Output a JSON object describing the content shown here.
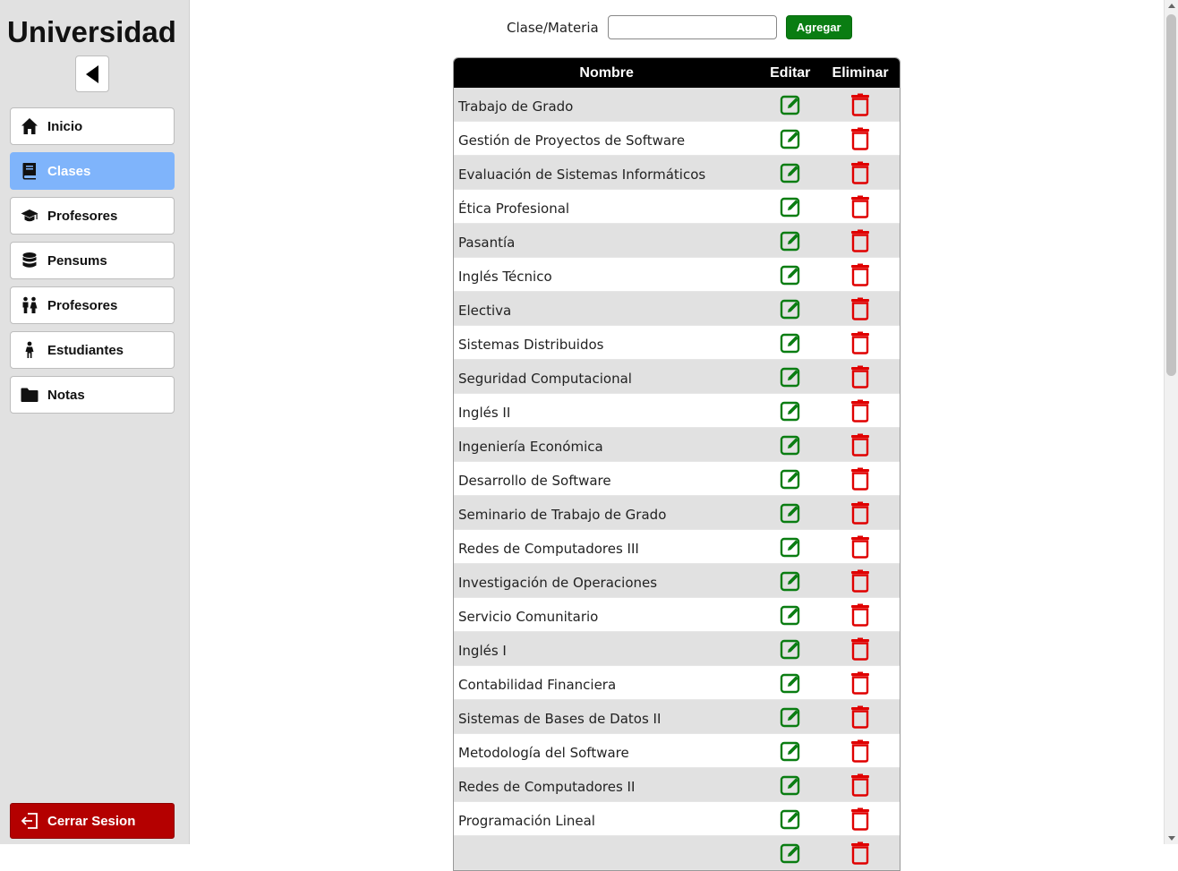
{
  "sidebar": {
    "brand": "Universidad",
    "items": [
      {
        "label": "Inicio",
        "icon": "home-icon",
        "active": false
      },
      {
        "label": "Clases",
        "icon": "book-icon",
        "active": true
      },
      {
        "label": "Profesores",
        "icon": "graduation-cap-icon",
        "active": false
      },
      {
        "label": "Pensums",
        "icon": "database-icon",
        "active": false
      },
      {
        "label": "Profesores",
        "icon": "people-icon",
        "active": false
      },
      {
        "label": "Estudiantes",
        "icon": "person-icon",
        "active": false
      },
      {
        "label": "Notas",
        "icon": "folder-icon",
        "active": false
      }
    ],
    "logout_label": "Cerrar Sesion"
  },
  "form": {
    "label": "Clase/Materia",
    "input_value": "",
    "add_label": "Agregar"
  },
  "table": {
    "headers": {
      "name": "Nombre",
      "edit": "Editar",
      "delete": "Eliminar"
    },
    "rows": [
      "Trabajo de Grado",
      "Gestión de Proyectos de Software",
      "Evaluación de Sistemas Informáticos",
      "Ética Profesional",
      "Pasantía",
      "Inglés Técnico",
      "Electiva",
      "Sistemas Distribuidos",
      "Seguridad Computacional",
      "Inglés II",
      "Ingeniería Económica",
      "Desarrollo de Software",
      "Seminario de Trabajo de Grado",
      "Redes de Computadores III",
      "Investigación de Operaciones",
      "Servicio Comunitario",
      "Inglés I",
      "Contabilidad Financiera",
      "Sistemas de Bases de Datos II",
      "Metodología del Software",
      "Redes de Computadores II",
      "Programación Lineal",
      ""
    ]
  },
  "colors": {
    "active_nav": "#7fb4fb",
    "add_button": "#0a7d12",
    "edit_icon": "#0a7d12",
    "delete_icon": "#e00000",
    "logout": "#b40000"
  }
}
